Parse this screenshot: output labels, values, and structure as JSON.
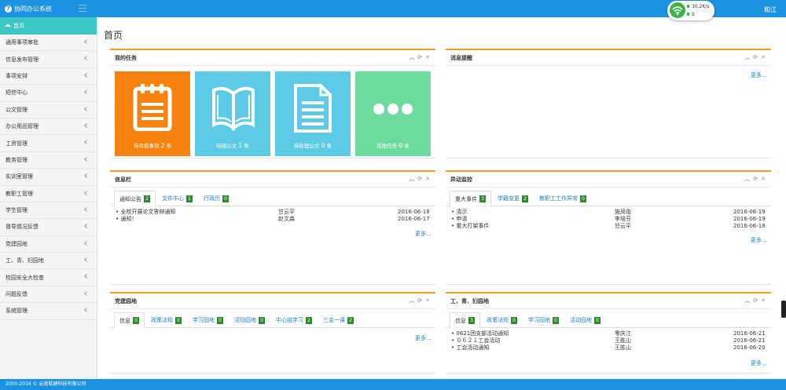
{
  "app": {
    "title": "协同办公系统",
    "user": "和江"
  },
  "network": {
    "speed": "30.2K/s",
    "count": "5"
  },
  "sidebar": {
    "home": "首页",
    "items": [
      "通用事项审批",
      "信息发布管理",
      "事项安排",
      "短信中心",
      "公文管理",
      "办公用品管理",
      "工资管理",
      "教务管理",
      "实训室管理",
      "教职工管理",
      "学生管理",
      "督导情况反馈",
      "党建园地",
      "工、青、妇园地",
      "校园安全大检查",
      "问题反馈",
      "系统管理"
    ]
  },
  "page": {
    "title": "首页"
  },
  "tasks": {
    "title": "我的任务",
    "tiles": [
      {
        "label": "待审核事项",
        "count": "2",
        "unit": "条",
        "color": "#f7820d",
        "icon": "notepad-icon"
      },
      {
        "label": "待阅公文",
        "count": "1",
        "unit": "条",
        "color": "#5ecbe6",
        "icon": "open-book-icon"
      },
      {
        "label": "待处理公文",
        "count": "0",
        "unit": "条",
        "color": "#5ecbe6",
        "icon": "document-icon"
      },
      {
        "label": "其他任务",
        "count": "0",
        "unit": "条",
        "color": "#6edb9e",
        "icon": "ellipsis-icon"
      }
    ]
  },
  "messages": {
    "title": "消息提醒",
    "more": "更多..."
  },
  "info": {
    "title": "信息栏",
    "tabs": [
      {
        "label": "通知公告",
        "count": "2"
      },
      {
        "label": "文件中心",
        "count": "1"
      },
      {
        "label": "行政历",
        "count": "0"
      }
    ],
    "rows": [
      {
        "title": "全校开展论文答辩通知",
        "author": "甘云平",
        "date": "2016-06-18"
      },
      {
        "title": "通知！",
        "author": "赵文森",
        "date": "2016-06-17"
      }
    ],
    "more": "更多..."
  },
  "monitor": {
    "title": "异动监控",
    "tabs": [
      {
        "label": "重大事件",
        "count": "3"
      },
      {
        "label": "学籍变更",
        "count": "2"
      },
      {
        "label": "教职工工作异常",
        "count": "0"
      }
    ],
    "rows": [
      {
        "title": "清示",
        "author": "施凤临",
        "date": "2016-06-19"
      },
      {
        "title": "申请",
        "author": "李培芬",
        "date": "2016-06-19"
      },
      {
        "title": "重大打架事件",
        "author": "甘云平",
        "date": "2016-06-18"
      }
    ],
    "more": "更多..."
  },
  "party": {
    "title": "党建园地",
    "tabs": [
      {
        "label": "信息",
        "count": "0"
      },
      {
        "label": "政策法规",
        "count": "0"
      },
      {
        "label": "学习园地",
        "count": "0"
      },
      {
        "label": "活动园地",
        "count": "0"
      },
      {
        "label": "中心组学习",
        "count": "2"
      },
      {
        "label": "三会一课",
        "count": "2"
      }
    ],
    "more": "更多..."
  },
  "union": {
    "title": "工、青、妇园地",
    "tabs": [
      {
        "label": "信息",
        "count": "3"
      },
      {
        "label": "政策法规",
        "count": "0"
      },
      {
        "label": "学习园地",
        "count": "0"
      },
      {
        "label": "活动园地",
        "count": "0"
      }
    ],
    "rows": [
      {
        "title": "0621团支部活动通知",
        "author": "零庆江",
        "date": "2016-06-21"
      },
      {
        "title": "０６２１工会活动",
        "author": "王胜山",
        "date": "2016-06-21"
      },
      {
        "title": "工会活动通知",
        "author": "王胜山",
        "date": "2016-06-20"
      }
    ],
    "more": "更多..."
  },
  "footer": {
    "text": "2000-2016 © 云南软建科技有限公司"
  }
}
